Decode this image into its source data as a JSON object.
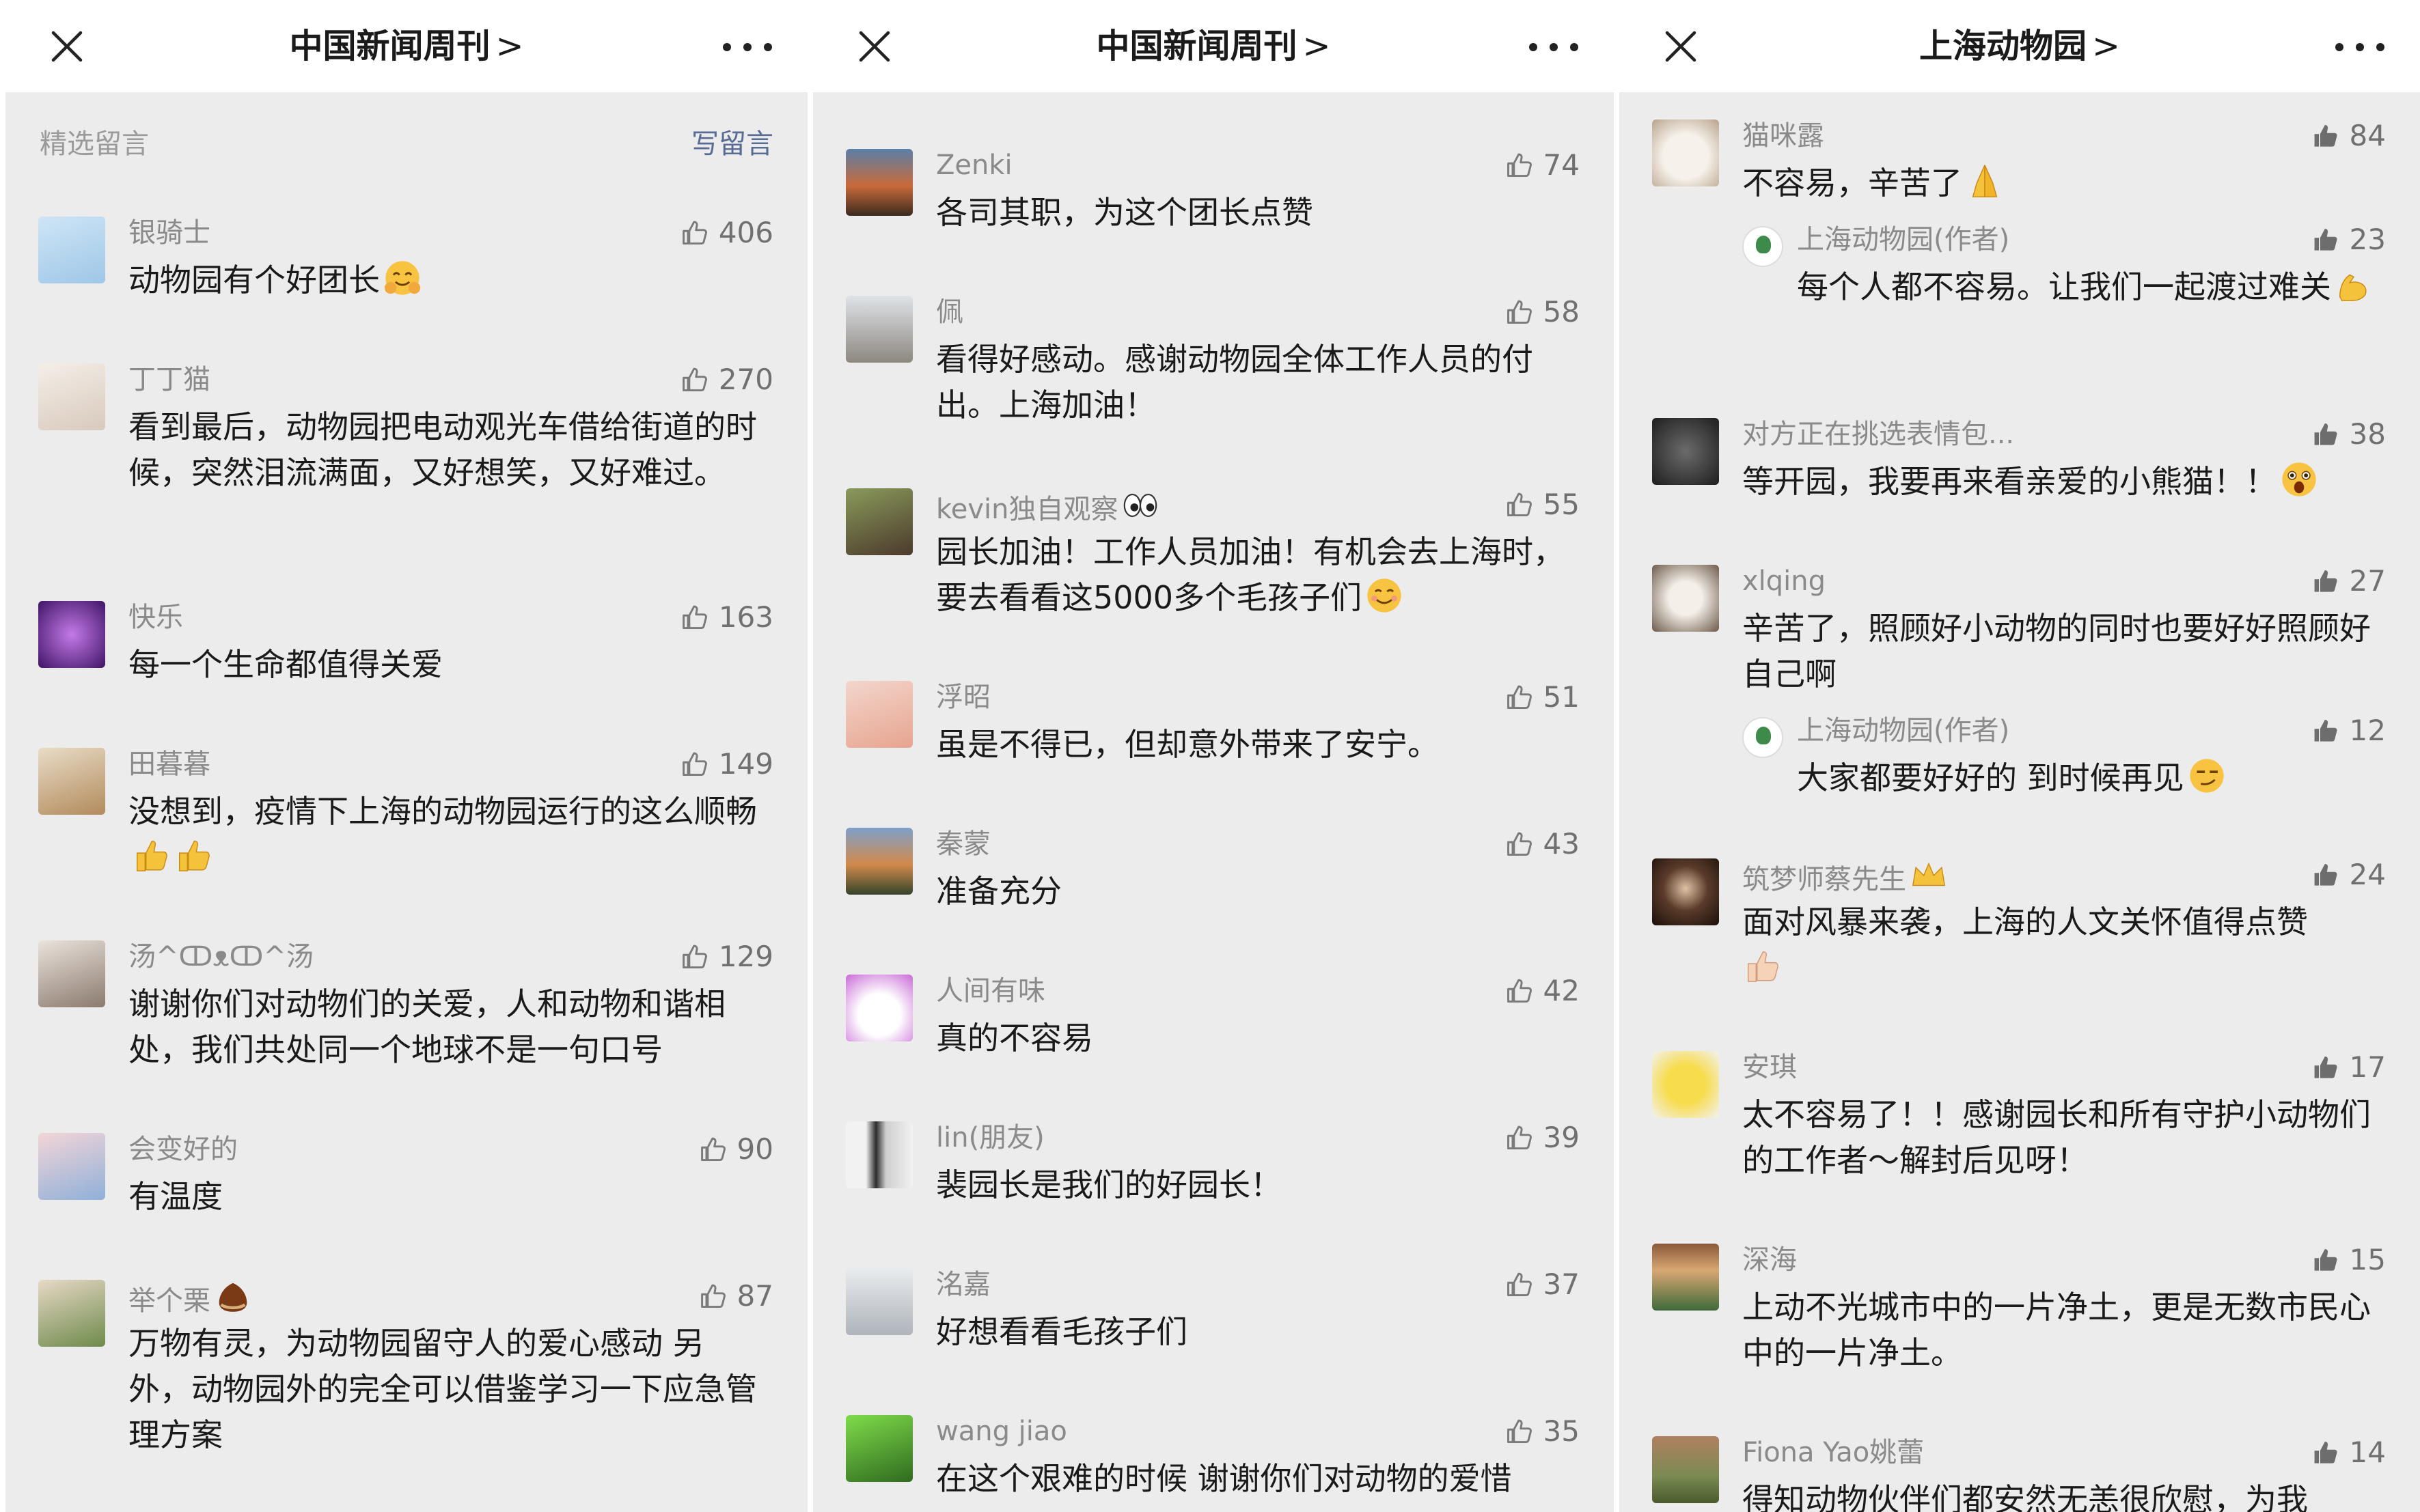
{
  "panels": [
    {
      "title": "中国新闻周刊",
      "chevron": ">",
      "section_label": "精选留言",
      "write_label": "写留言",
      "comments": [
        {
          "name": "银骑士",
          "likes": "406",
          "text": "动物园有个好团长"
        },
        {
          "name": "丁丁猫",
          "likes": "270",
          "text": "看到最后，动物园把电动观光车借给街道的时候，突然泪流满面，又好想笑，又好难过。"
        },
        {
          "name": "快乐",
          "likes": "163",
          "text": "每一个生命都值得关爱"
        },
        {
          "name": "田暮暮",
          "likes": "149",
          "text": "没想到，疫情下上海的动物园运行的这么顺畅"
        },
        {
          "name": "汤^ↀᴥↀ^汤",
          "likes": "129",
          "text": "谢谢你们对动物们的关爱，人和动物和谐相处，我们共处同一个地球不是一句口号"
        },
        {
          "name": "会变好的",
          "likes": "90",
          "text": "有温度"
        },
        {
          "name": "举个栗",
          "likes": "87",
          "text": "万物有灵，为动物园留守人的爱心感动 另外，动物园外的完全可以借鉴学习一下应急管理方案"
        }
      ]
    },
    {
      "title": "中国新闻周刊",
      "chevron": ">",
      "comments": [
        {
          "name": "Zenki",
          "likes": "74",
          "text": "各司其职，为这个团长点赞"
        },
        {
          "name": "佩",
          "likes": "58",
          "text": "看得好感动。感谢动物园全体工作人员的付出。上海加油！"
        },
        {
          "name": "kevin独自观察",
          "likes": "55",
          "text": "园长加油！工作人员加油！有机会去上海时，要去看看这5000多个毛孩子们"
        },
        {
          "name": "浮昭",
          "likes": "51",
          "text": "虽是不得已，但却意外带来了安宁。"
        },
        {
          "name": "秦蒙",
          "likes": "43",
          "text": "准备充分"
        },
        {
          "name": "人间有味",
          "likes": "42",
          "text": "真的不容易"
        },
        {
          "name": "lin(朋友)",
          "likes": "39",
          "text": "裴园长是我们的好园长！"
        },
        {
          "name": "洺嘉",
          "likes": "37",
          "text": "好想看看毛孩子们"
        },
        {
          "name": "wang jiao",
          "likes": "35",
          "text": "在这个艰难的时候 谢谢你们对动物的爱惜"
        }
      ]
    },
    {
      "title": "上海动物园",
      "chevron": ">",
      "comments": [
        {
          "name": "猫咪露",
          "likes": "84",
          "text": "不容易，辛苦了",
          "reply": {
            "name": "上海动物园(作者)",
            "likes": "23",
            "text": "每个人都不容易。让我们一起渡过难关"
          }
        },
        {
          "name": "对方正在挑选表情包...",
          "likes": "38",
          "text": "等开园，我要再来看亲爱的小熊猫！！"
        },
        {
          "name": "xlqing",
          "likes": "27",
          "text": "辛苦了，照顾好小动物的同时也要好好照顾好自己啊",
          "reply": {
            "name": "上海动物园(作者)",
            "likes": "12",
            "text": "大家都要好好的 到时候再见"
          }
        },
        {
          "name": "筑梦师蔡先生",
          "likes": "24",
          "text": "面对风暴来袭，上海的人文关怀值得点赞"
        },
        {
          "name": "安琪",
          "likes": "17",
          "text": "太不容易了！！感谢园长和所有守护小动物们的工作者～解封后见呀！"
        },
        {
          "name": "深海",
          "likes": "15",
          "text": "上动不光城市中的一片净土，更是无数市民心中的一片净土。"
        },
        {
          "name": "Fiona Yao姚蕾",
          "likes": "14",
          "text": "得知动物伙伴们都安然无恙很欣慰，为我"
        }
      ]
    }
  ],
  "icons": {
    "close": "close-icon",
    "more": "more-icon",
    "like": "thumbs-up-icon"
  },
  "colors": {
    "link": "#576b95",
    "meta": "#8a8a8a",
    "background": "#ececec"
  }
}
